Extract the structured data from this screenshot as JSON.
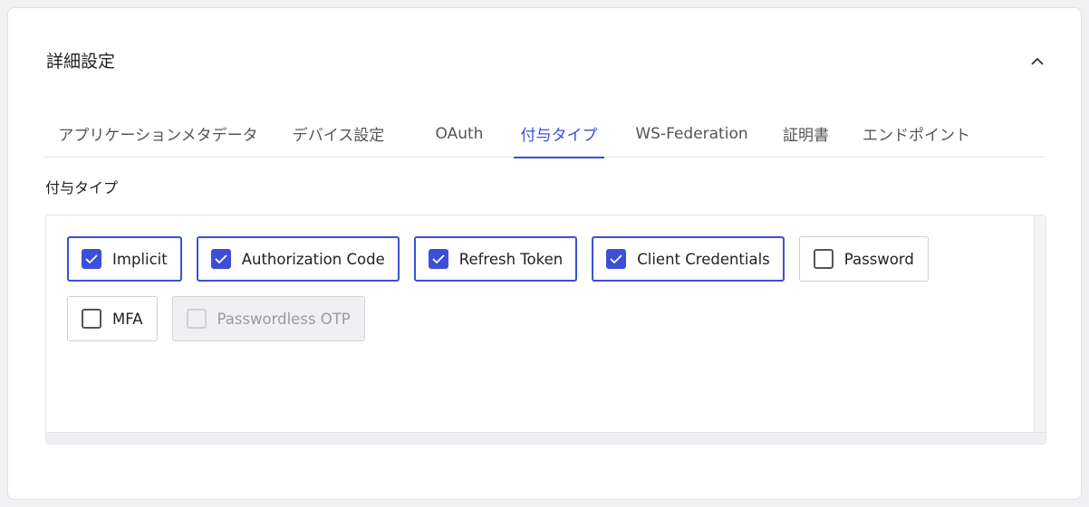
{
  "section": {
    "title": "詳細設定",
    "collapse_icon": "chevron-up-icon"
  },
  "tabs": [
    {
      "label": "アプリケーションメタデータ",
      "active": false
    },
    {
      "label": "デバイス設定",
      "active": false
    },
    {
      "label": "OAuth",
      "active": false
    },
    {
      "label": "付与タイプ",
      "active": true
    },
    {
      "label": "WS-Federation",
      "active": false
    },
    {
      "label": "証明書",
      "active": false
    },
    {
      "label": "エンドポイント",
      "active": false
    }
  ],
  "grant_types": {
    "label": "付与タイプ",
    "options": [
      {
        "label": "Implicit",
        "checked": true,
        "disabled": false
      },
      {
        "label": "Authorization Code",
        "checked": true,
        "disabled": false
      },
      {
        "label": "Refresh Token",
        "checked": true,
        "disabled": false
      },
      {
        "label": "Client Credentials",
        "checked": true,
        "disabled": false
      },
      {
        "label": "Password",
        "checked": false,
        "disabled": false
      },
      {
        "label": "MFA",
        "checked": false,
        "disabled": false
      },
      {
        "label": "Passwordless OTP",
        "checked": false,
        "disabled": true
      }
    ]
  },
  "colors": {
    "accent": "#3d4fd6",
    "border": "#cfcfd4",
    "disabled_bg": "#f0f0f2"
  }
}
